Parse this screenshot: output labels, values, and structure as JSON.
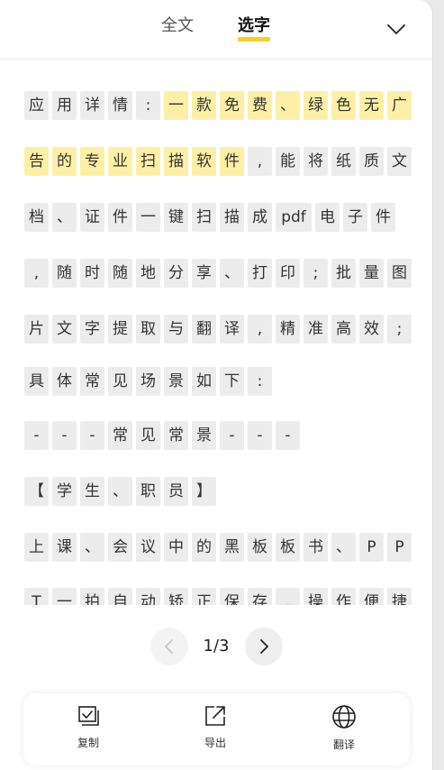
{
  "header": {
    "tab_full": "全文",
    "tab_select": "选字",
    "accent_color": "#f7cf2b",
    "collapse_icon": "chevron-down-icon"
  },
  "text_lines": [
    [
      {
        "t": "应",
        "s": false
      },
      {
        "t": "用",
        "s": false
      },
      {
        "t": "详",
        "s": false
      },
      {
        "t": "情",
        "s": false
      },
      {
        "t": ":",
        "s": false
      },
      {
        "t": "一",
        "s": true
      },
      {
        "t": "款",
        "s": true
      },
      {
        "t": "免",
        "s": true
      },
      {
        "t": "费",
        "s": true
      },
      {
        "t": "、",
        "s": true
      },
      {
        "t": "绿",
        "s": true
      },
      {
        "t": "色",
        "s": true
      },
      {
        "t": "无",
        "s": true
      },
      {
        "t": "广",
        "s": true
      }
    ],
    [
      {
        "t": "告",
        "s": true
      },
      {
        "t": "的",
        "s": true
      },
      {
        "t": "专",
        "s": true
      },
      {
        "t": "业",
        "s": true
      },
      {
        "t": "扫",
        "s": true
      },
      {
        "t": "描",
        "s": true
      },
      {
        "t": "软",
        "s": true
      },
      {
        "t": "件",
        "s": true
      },
      {
        "t": ",",
        "s": false
      },
      {
        "t": "能",
        "s": false
      },
      {
        "t": "将",
        "s": false
      },
      {
        "t": "纸",
        "s": false
      },
      {
        "t": "质",
        "s": false
      },
      {
        "t": "文",
        "s": false
      }
    ],
    [
      {
        "t": "档",
        "s": false
      },
      {
        "t": "、",
        "s": false
      },
      {
        "t": "证",
        "s": false
      },
      {
        "t": "件",
        "s": false
      },
      {
        "t": "一",
        "s": false
      },
      {
        "t": "键",
        "s": false
      },
      {
        "t": "扫",
        "s": false
      },
      {
        "t": "描",
        "s": false
      },
      {
        "t": "成",
        "s": false
      },
      {
        "t": "pdf",
        "s": false,
        "w": true
      },
      {
        "t": "电",
        "s": false
      },
      {
        "t": "子",
        "s": false
      },
      {
        "t": "件",
        "s": false
      }
    ],
    [
      {
        "t": ",",
        "s": false
      },
      {
        "t": "随",
        "s": false
      },
      {
        "t": "时",
        "s": false
      },
      {
        "t": "随",
        "s": false
      },
      {
        "t": "地",
        "s": false
      },
      {
        "t": "分",
        "s": false
      },
      {
        "t": "享",
        "s": false
      },
      {
        "t": "、",
        "s": false
      },
      {
        "t": "打",
        "s": false
      },
      {
        "t": "印",
        "s": false
      },
      {
        "t": ";",
        "s": false
      },
      {
        "t": "批",
        "s": false
      },
      {
        "t": "量",
        "s": false
      },
      {
        "t": "图",
        "s": false
      }
    ],
    [
      {
        "t": "片",
        "s": false
      },
      {
        "t": "文",
        "s": false
      },
      {
        "t": "字",
        "s": false
      },
      {
        "t": "提",
        "s": false
      },
      {
        "t": "取",
        "s": false
      },
      {
        "t": "与",
        "s": false
      },
      {
        "t": "翻",
        "s": false
      },
      {
        "t": "译",
        "s": false
      },
      {
        "t": ",",
        "s": false
      },
      {
        "t": "精",
        "s": false
      },
      {
        "t": "准",
        "s": false
      },
      {
        "t": "高",
        "s": false
      },
      {
        "t": "效",
        "s": false
      },
      {
        "t": ";",
        "s": false
      }
    ],
    [
      {
        "t": "具",
        "s": false
      },
      {
        "t": "体",
        "s": false
      },
      {
        "t": "常",
        "s": false
      },
      {
        "t": "见",
        "s": false
      },
      {
        "t": "场",
        "s": false
      },
      {
        "t": "景",
        "s": false
      },
      {
        "t": "如",
        "s": false
      },
      {
        "t": "下",
        "s": false
      },
      {
        "t": ":",
        "s": false
      }
    ],
    [
      {
        "t": "-",
        "s": false
      },
      {
        "t": "-",
        "s": false
      },
      {
        "t": "-",
        "s": false
      },
      {
        "t": "常",
        "s": false
      },
      {
        "t": "见",
        "s": false
      },
      {
        "t": "常",
        "s": false
      },
      {
        "t": "景",
        "s": false
      },
      {
        "t": "-",
        "s": false
      },
      {
        "t": "-",
        "s": false
      },
      {
        "t": "-",
        "s": false
      }
    ],
    [
      {
        "t": "【",
        "s": false
      },
      {
        "t": "学",
        "s": false
      },
      {
        "t": "生",
        "s": false
      },
      {
        "t": "、",
        "s": false
      },
      {
        "t": "职",
        "s": false
      },
      {
        "t": "员",
        "s": false
      },
      {
        "t": "】",
        "s": false
      }
    ],
    [
      {
        "t": "上",
        "s": false
      },
      {
        "t": "课",
        "s": false
      },
      {
        "t": "、",
        "s": false
      },
      {
        "t": "会",
        "s": false
      },
      {
        "t": "议",
        "s": false
      },
      {
        "t": "中",
        "s": false
      },
      {
        "t": "的",
        "s": false
      },
      {
        "t": "黑",
        "s": false
      },
      {
        "t": "板",
        "s": false
      },
      {
        "t": "板",
        "s": false
      },
      {
        "t": "书",
        "s": false
      },
      {
        "t": "、",
        "s": false
      },
      {
        "t": "P",
        "s": false
      },
      {
        "t": "P",
        "s": false
      }
    ],
    [
      {
        "t": "T",
        "s": false
      },
      {
        "t": "一",
        "s": false
      },
      {
        "t": "拍",
        "s": false
      },
      {
        "t": "自",
        "s": false
      },
      {
        "t": "动",
        "s": false
      },
      {
        "t": "矫",
        "s": false
      },
      {
        "t": "正",
        "s": false
      },
      {
        "t": "保",
        "s": false
      },
      {
        "t": "存",
        "s": false
      },
      {
        "t": ",",
        "s": false
      },
      {
        "t": "操",
        "s": false
      },
      {
        "t": "作",
        "s": false
      },
      {
        "t": "便",
        "s": false
      },
      {
        "t": "捷",
        "s": false
      }
    ]
  ],
  "pager": {
    "current": 1,
    "total": 3,
    "label": "1/3",
    "prev_icon": "chevron-left-icon",
    "next_icon": "chevron-right-icon"
  },
  "toolbar": {
    "copy_label": "复制",
    "export_label": "导出",
    "translate_label": "翻译",
    "copy_icon": "copy-check-icon",
    "export_icon": "export-icon",
    "translate_icon": "globe-icon"
  }
}
